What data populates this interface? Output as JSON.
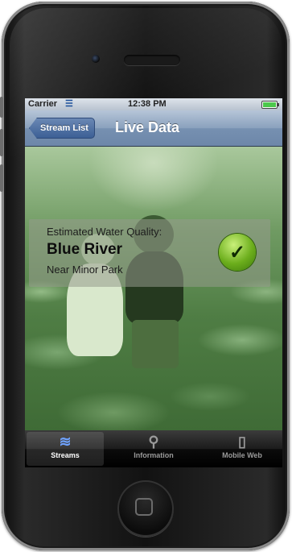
{
  "status_bar": {
    "carrier": "Carrier",
    "time": "12:38 PM",
    "battery_level": 1.0
  },
  "nav": {
    "back_label": "Stream List",
    "title": "Live Data"
  },
  "card": {
    "eyebrow": "Estimated Water Quality:",
    "river": "Blue River",
    "location": "Near Minor Park",
    "status_icon": "checkmark-icon"
  },
  "tabs": [
    {
      "label": "Streams",
      "icon": "chart-icon",
      "active": true
    },
    {
      "label": "Information",
      "icon": "search-icon",
      "active": false
    },
    {
      "label": "Mobile Web",
      "icon": "phone-icon",
      "active": false
    }
  ],
  "colors": {
    "nav_blue": "#6d87a9",
    "check_green": "#6cae1c",
    "tab_active": "#6fa3ff"
  }
}
